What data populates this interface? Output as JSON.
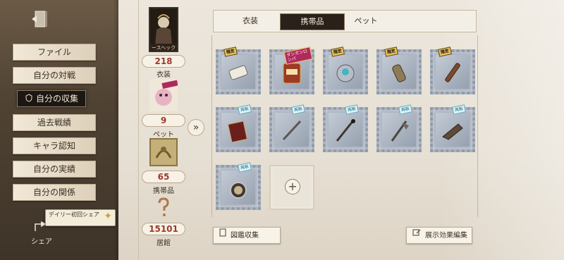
{
  "sidebar": {
    "items": [
      {
        "label": "ファイル"
      },
      {
        "label": "自分の対戦"
      },
      {
        "label": "自分の収集"
      },
      {
        "label": "過去戦績"
      },
      {
        "label": "キャラ認知"
      },
      {
        "label": "自分の実績"
      },
      {
        "label": "自分の関係"
      }
    ],
    "active_index": 2,
    "daily_share": "デイリー初回シェア",
    "share_label": "シェア"
  },
  "stats": {
    "costume_caption": "ースヘック",
    "costume_count": "218",
    "costume_label": "衣装",
    "pet_count": "9",
    "pet_label": "ペット",
    "accessory_count": "65",
    "accessory_label": "携帯品",
    "residence_count": "15101",
    "residence_label": "居館"
  },
  "tabs": [
    {
      "label": "衣装"
    },
    {
      "label": "携帯品",
      "active": true
    },
    {
      "label": "ペット"
    }
  ],
  "grid": {
    "rows": [
      [
        {
          "icon": "scroll-icon",
          "badge": "限定",
          "badge_type": "limited"
        },
        {
          "icon": "slot-machine-icon",
          "badge": "ダンガンロンパ",
          "badge_type": "collab"
        },
        {
          "icon": "orb-icon",
          "badge": "限定",
          "badge_type": "limited"
        },
        {
          "icon": "lantern-icon",
          "badge": "限定",
          "badge_type": "limited"
        },
        {
          "icon": "telescope-icon",
          "badge": "限定",
          "badge_type": "limited"
        }
      ],
      [
        {
          "icon": "book-icon",
          "badge": "再販",
          "badge_type": "loop"
        },
        {
          "icon": "sword-icon",
          "badge": "再販",
          "badge_type": "loop"
        },
        {
          "icon": "staff-icon",
          "badge": "再販",
          "badge_type": "loop"
        },
        {
          "icon": "axe-icon",
          "badge": "再販",
          "badge_type": "loop"
        },
        {
          "icon": "tool-icon",
          "badge": "再販",
          "badge_type": "loop"
        }
      ],
      [
        {
          "icon": "locket-icon",
          "badge": "再販",
          "badge_type": "loop"
        },
        {
          "icon": "add-icon",
          "empty": true
        }
      ]
    ]
  },
  "buttons": {
    "collection": "図鑑収集",
    "edit_display": "展示効果編集"
  },
  "colors": {
    "accent_dark": "#2a221a",
    "value_red": "#9b3b2d",
    "parchment": "#ece6dc"
  }
}
